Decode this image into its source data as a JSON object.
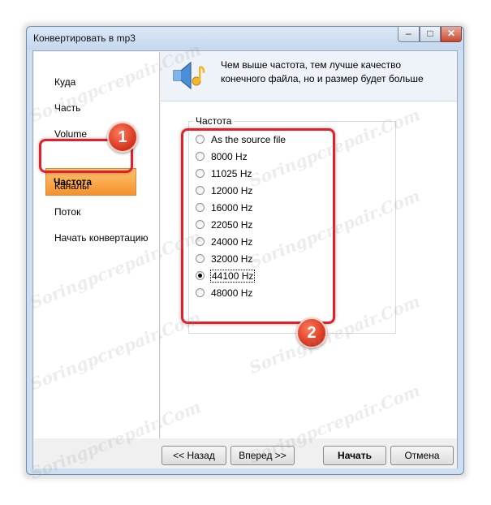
{
  "window": {
    "title": "Конвертировать в mp3",
    "min_label": "–",
    "max_label": "□",
    "close_label": "✕"
  },
  "sidebar": {
    "items": [
      {
        "label": "Куда"
      },
      {
        "label": "Часть"
      },
      {
        "label": "Volume"
      },
      {
        "label": "Частота",
        "active": true
      },
      {
        "label": "Каналы"
      },
      {
        "label": "Поток"
      },
      {
        "label": "Начать конвертацию"
      }
    ]
  },
  "header": {
    "icon": "speaker-music-icon",
    "text": "Чем выше частота, тем лучше качество конечного файла, но и размер будет больше"
  },
  "frequency_group": {
    "title": "Частота",
    "options": [
      {
        "label": "As the source file",
        "checked": false
      },
      {
        "label": "8000 Hz",
        "checked": false
      },
      {
        "label": "11025 Hz",
        "checked": false
      },
      {
        "label": "12000 Hz",
        "checked": false
      },
      {
        "label": "16000 Hz",
        "checked": false
      },
      {
        "label": "22050 Hz",
        "checked": false
      },
      {
        "label": "24000 Hz",
        "checked": false
      },
      {
        "label": "32000 Hz",
        "checked": false
      },
      {
        "label": "44100 Hz",
        "checked": true
      },
      {
        "label": "48000 Hz",
        "checked": false
      }
    ]
  },
  "buttons": {
    "back": "<< Назад",
    "next": "Вперед >>",
    "start": "Начать",
    "cancel": "Отмена"
  },
  "annotations": {
    "badge_1": "1",
    "badge_2": "2",
    "accent_color": "#e0202a"
  },
  "watermark_text": "Soringpcrepair.Com"
}
